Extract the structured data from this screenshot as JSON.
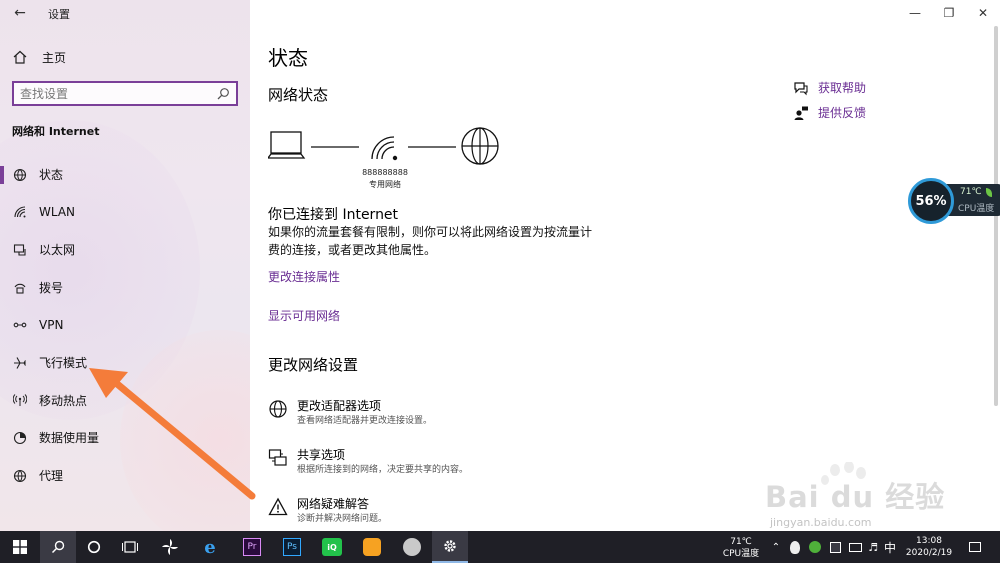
{
  "window": {
    "app_title": "设置"
  },
  "sidebar": {
    "home_label": "主页",
    "search_placeholder": "查找设置",
    "section_title": "网络和 Internet",
    "items": [
      {
        "label": "状态",
        "icon": "status-icon"
      },
      {
        "label": "WLAN",
        "icon": "wifi-icon"
      },
      {
        "label": "以太网",
        "icon": "ethernet-icon"
      },
      {
        "label": "拨号",
        "icon": "dialup-icon"
      },
      {
        "label": "VPN",
        "icon": "vpn-icon"
      },
      {
        "label": "飞行模式",
        "icon": "airplane-icon"
      },
      {
        "label": "移动热点",
        "icon": "hotspot-icon"
      },
      {
        "label": "数据使用量",
        "icon": "data-usage-icon"
      },
      {
        "label": "代理",
        "icon": "globe-icon"
      }
    ],
    "active_index": 0
  },
  "main": {
    "title": "状态",
    "network_status_title": "网络状态",
    "network_name": "888888888",
    "network_type": "专用网络",
    "connected_text": "你已连接到 Internet",
    "description": "如果你的流量套餐有限制，则你可以将此网络设置为按流量计费的连接，或者更改其他属性。",
    "link_change_props": "更改连接属性",
    "link_show_networks": "显示可用网络",
    "change_settings_title": "更改网络设置",
    "options": [
      {
        "title": "更改适配器选项",
        "desc": "查看网络适配器并更改连接设置。"
      },
      {
        "title": "共享选项",
        "desc": "根据所连接到的网络，决定要共享的内容。"
      },
      {
        "title": "网络疑难解答",
        "desc": "诊断并解决网络问题。"
      }
    ],
    "help_label": "获取帮助",
    "feedback_label": "提供反馈"
  },
  "cpu_widget": {
    "usage": "56%",
    "temp": "71℃",
    "label": "CPU温度"
  },
  "watermark": {
    "text": "Bai du 经验",
    "url": "jingyan.baidu.com"
  },
  "taskbar": {
    "tray_temp": "71℃",
    "tray_temp_label": "CPU温度",
    "ime": "中",
    "time": "13:08",
    "date": "2020/2/19",
    "apps": [
      "start",
      "search",
      "cortana",
      "task-view",
      "pinwheel",
      "ie",
      "premiere",
      "photoshop",
      "iqiyi",
      "uc",
      "feather",
      "settings"
    ]
  },
  "colors": {
    "accent": "#7a3f98",
    "link": "#6a2e93",
    "taskbar": "#1f1f26",
    "annotation_arrow": "#f47c3a"
  }
}
